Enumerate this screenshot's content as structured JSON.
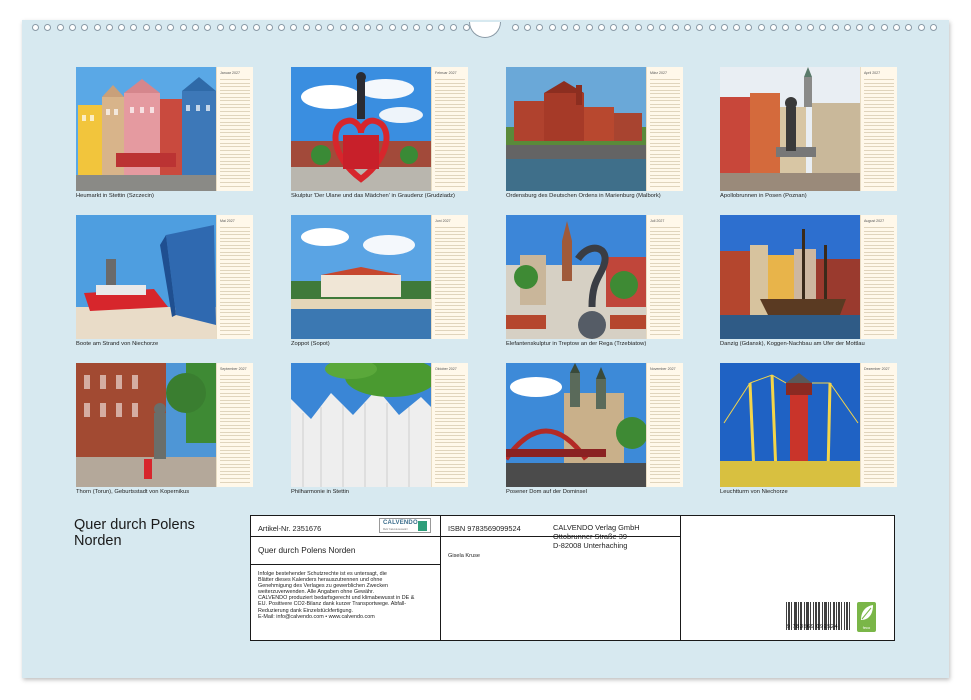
{
  "document": {
    "title_line1": "Quer durch Polens",
    "title_line2": "Norden"
  },
  "months": [
    {
      "month": "Januar 2027",
      "caption": "Heumarkt in Stettin (Szczecin)"
    },
    {
      "month": "Februar 2027",
      "caption": "Skulptur 'Der Ulane und das Mädchen' in Graudenz (Grudziadz)"
    },
    {
      "month": "März 2027",
      "caption": "Ordensburg des Deutschen Ordens in Marienburg (Malbork)"
    },
    {
      "month": "April 2027",
      "caption": "Apollobrunnen in Posen (Poznan)"
    },
    {
      "month": "Mai 2027",
      "caption": "Boote am Strand von Niechorze"
    },
    {
      "month": "Juni 2027",
      "caption": "Zoppot (Sopot)"
    },
    {
      "month": "Juli 2027",
      "caption": "Elefantenskulptur in Treptow an der Rega (Trzebiatow)"
    },
    {
      "month": "August 2027",
      "caption": "Danzig (Gdansk), Koggen-Nachbau am Ufer der Mottlau"
    },
    {
      "month": "September 2027",
      "caption": "Thorn (Torun), Geburtsstadt von Kopernikus"
    },
    {
      "month": "Oktober 2027",
      "caption": "Philharmonie in Stettin"
    },
    {
      "month": "November 2027",
      "caption": "Posener Dom auf der Dominsel"
    },
    {
      "month": "Dezember 2027",
      "caption": "Leuchtturm von Niechorze"
    }
  ],
  "info_panel": {
    "article_no": "Artikel-Nr. 2351676",
    "logo_text": "CALVENDO",
    "logo_sub": "Mehr Kalenderauswahl",
    "calendar_title": "Quer durch Polens Norden",
    "legal_lines": [
      "Infolge bestehender Schutzrechte ist es untersagt, die",
      "Blätter dieses Kalenders herauszutrennen und ohne",
      "Genehmigung des Verlages zu gewerblichen Zwecken",
      "weiterzuverwenden. Alle Angaben ohne Gewähr.",
      "CALVENDO produziert bedarfsgerecht und klimabewusst in DE &",
      "EU. Positivere CO2-Bilanz dank kurzer Transportwege. Abfall-",
      "Reduzierung dank Einzelstückfertigung.",
      "E-Mail: info@calvendo.com • www.calvendo.com"
    ],
    "isbn": "ISBN 9783569099524",
    "publisher_line1": "CALVENDO Verlag GmbH",
    "publisher_line2": "Ottobrunner Straße 39",
    "publisher_line3": "D-82008 Unterhaching",
    "author": "Gisela Kruse",
    "barcode_number": "9 783569 099524",
    "eco_label": "feco"
  }
}
